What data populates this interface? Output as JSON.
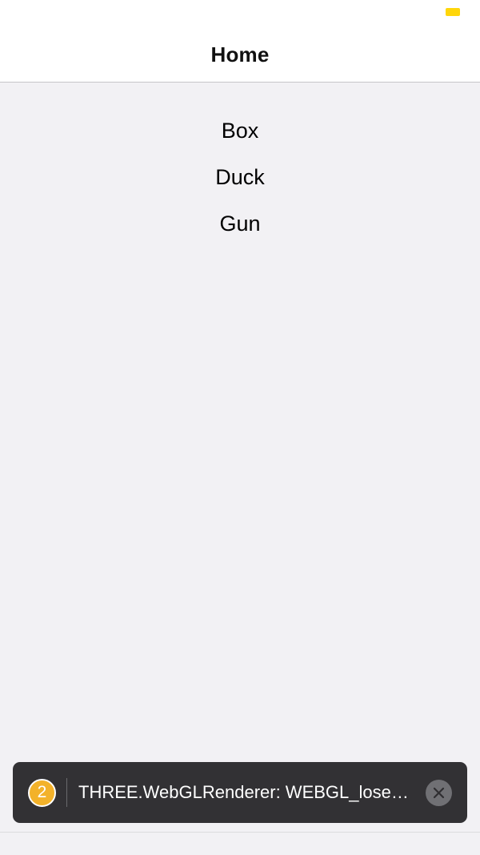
{
  "status_bar": {
    "battery_color": "#ffd60a"
  },
  "nav": {
    "title": "Home"
  },
  "menu": {
    "items": [
      {
        "label": "Box"
      },
      {
        "label": "Duck"
      },
      {
        "label": "Gun"
      }
    ]
  },
  "toast": {
    "count": "2",
    "message": "THREE.WebGLRenderer: WEBGL_lose_context extension not supported.",
    "close_icon": "close-icon",
    "badge_color": "#f3b22a"
  }
}
